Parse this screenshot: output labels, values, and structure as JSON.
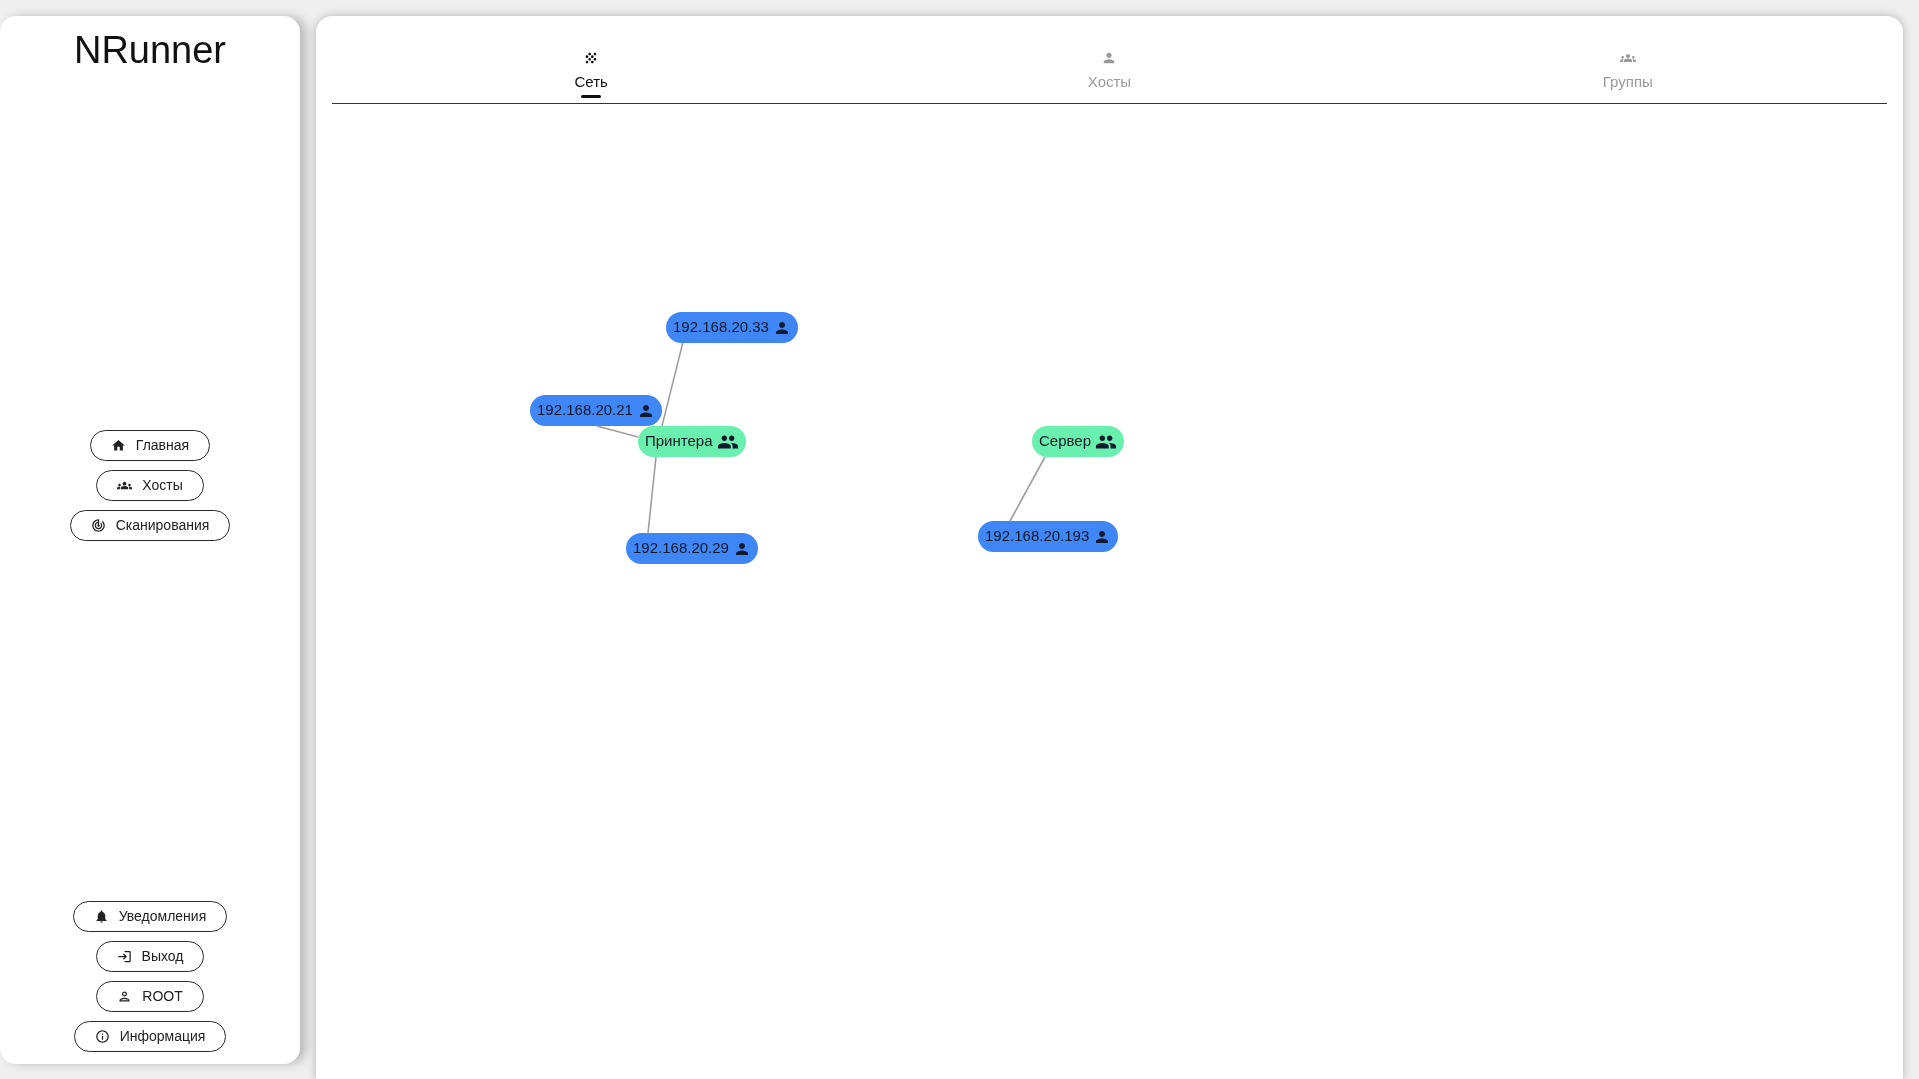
{
  "sidebar": {
    "app_title": "NRunner",
    "nav": [
      {
        "label": "Главная"
      },
      {
        "label": "Хосты"
      },
      {
        "label": "Сканирования"
      }
    ],
    "footer_nav": [
      {
        "label": "Уведомления"
      },
      {
        "label": "Выход"
      },
      {
        "label": "ROOT"
      },
      {
        "label": "Информация"
      }
    ]
  },
  "tabs": [
    {
      "label": "Сеть",
      "selected": true
    },
    {
      "label": "Хосты",
      "selected": false
    },
    {
      "label": "Группы",
      "selected": false
    }
  ],
  "graph": {
    "groups": [
      {
        "name": "Принтера",
        "hosts": [
          {
            "address": "192.168.20.33"
          },
          {
            "address": "192.168.20.21"
          },
          {
            "address": "192.168.20.29"
          }
        ]
      },
      {
        "name": "Сервер",
        "hosts": [
          {
            "address": "192.168.20.193"
          }
        ]
      }
    ]
  }
}
